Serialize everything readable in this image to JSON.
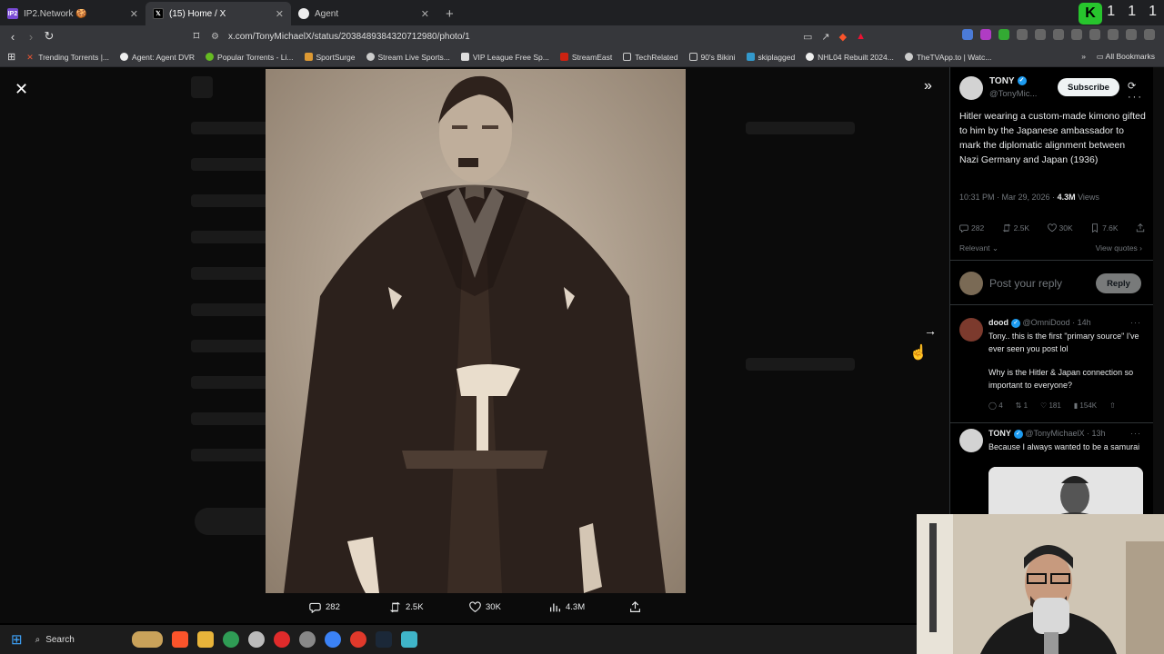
{
  "browser": {
    "tabs": [
      {
        "title": "IP2.Network 🍪",
        "favicon": "ip2-favicon",
        "active": false
      },
      {
        "title": "(15) Home / X",
        "favicon": "x-favicon",
        "active": true
      },
      {
        "title": "Agent",
        "favicon": "agent-favicon",
        "active": false
      }
    ],
    "new_tab": "+",
    "url": "x.com/TonyMichaelX/status/2038489384320712980/photo/1",
    "badge": "K",
    "window_controls": [
      "1",
      "1",
      "1"
    ],
    "bookmarks": [
      "Trending Torrents |...",
      "Agent: Agent DVR",
      "Popular Torrents - Li...",
      "SportSurge",
      "Stream Live Sports...",
      "VIP League Free Sp...",
      "StreamEast",
      "TechRelated",
      "90's Bikini",
      "skiplagged",
      "NHL04 Rebuilt 2024...",
      "TheTVApp.to | Watc..."
    ],
    "all_bookmarks": "All Bookmarks"
  },
  "viewer": {
    "actions": {
      "replies": "282",
      "reposts": "2.5K",
      "likes": "30K",
      "views": "4.3M"
    }
  },
  "post": {
    "author": "TONY",
    "handle": "@TonyMic...",
    "subscribe": "Subscribe",
    "text": "Hitler wearing a custom-made kimono gifted to him by the Japanese ambassador to mark the diplomatic alignment between Nazi Germany and Japan (1936)",
    "timestamp": "10:31 PM · Mar 29, 2026 · ",
    "views_count": "4.3M",
    "views_label": " Views",
    "stats": {
      "replies": "282",
      "reposts": "2.5K",
      "likes": "30K",
      "bookmarks": "7.6K"
    },
    "relevant": "Relevant ⌄",
    "view_quotes": "View quotes ›",
    "reply_placeholder": "Post your reply",
    "reply_button": "Reply"
  },
  "comments": [
    {
      "name": "dood",
      "handle": "@OmniDood · 14h",
      "text_1": "Tony.. this is the first \"primary source\" I've ever seen you post lol",
      "text_2": "Why is the Hitler & Japan connection so important to everyone?",
      "stats": {
        "replies": "4",
        "reposts": "1",
        "likes": "181",
        "views": "154K"
      }
    },
    {
      "name": "TONY",
      "handle": "@TonyMichaelX · 13h",
      "text_1": "Because I always wanted to be a samurai"
    }
  ],
  "taskbar": {
    "search": "Search"
  },
  "colors": {
    "accent": "#1d9bf0",
    "background": "#000000",
    "text": "#e7e9ea",
    "muted": "#71767b"
  }
}
